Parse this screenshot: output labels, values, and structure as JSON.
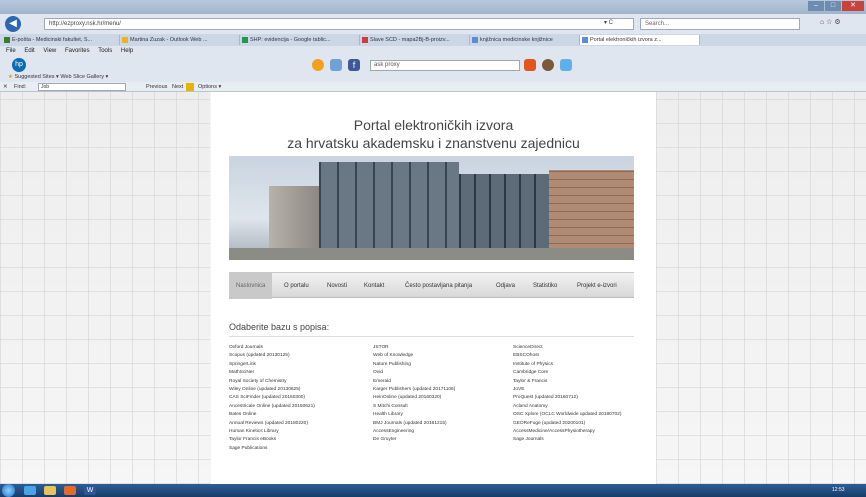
{
  "browser": {
    "address": "http://ezproxy.nsk.hr/menu/",
    "refresh_label": "▾ C",
    "search_placeholder": "Search...",
    "right_icons": "⌂ ☆ ⚙",
    "tabs": [
      "E-pošta - Medicinski fakultet, S...",
      "Martina Zuzak - Outlook Web ...",
      "SHP: evidencija - Google tablic...",
      "Slave SCD - mapa2Bj-B-proizv...",
      "knjižnica medicinske knjižnice",
      "Portal elektroničkih izvora z..."
    ],
    "menu": [
      "File",
      "Edit",
      "View",
      "Favorites",
      "Tools",
      "Help"
    ],
    "favorites": "Suggested Sites ▾   Web Slice Gallery ▾",
    "find_label": "Find:",
    "find_value": "Job",
    "find_prev": "Previous",
    "find_next": "Next",
    "find_options": "Options ▾",
    "toolbar_search": "ask proxy"
  },
  "portal": {
    "title": "Portal elektroničkih izvora",
    "subtitle": "za hrvatsku akademsku i znanstvenu zajednicu",
    "nav": [
      "Naslovnica",
      "O portalu",
      "Novosti",
      "Kontakt",
      "Često postavljana pitanja",
      "Odjava",
      "Statistiko",
      "Projekt e-izvori"
    ],
    "select_heading": "Odaberite bazu s popisa:",
    "databases": {
      "col1": [
        "Oxford Journals",
        "Scopus (updated 20130125)",
        "SpringerLink",
        "MathSciNet",
        "Royal Society of Chemistry",
        "Wiley Online (updated 20130625)",
        "CAS SciFinder (updated 20160300)",
        "Ancestricale Online (updated 20150621)",
        "Bates Online",
        "Annual Reviews (updated 20180220)",
        "Human Kinetics Library",
        "Taylor Francis eBooks",
        "Sage Publications"
      ],
      "col2": [
        "JSTOR",
        "Web of Knowledge",
        "Nature Publishing",
        "Ovid",
        "Emerald",
        "Karger Publishers (updated 20171106)",
        "HeinOnline (updated 20160320)",
        "S Mitchi Consult",
        "Health Library",
        "BMJ Journals (updated 20161215)",
        "AccessEngineering",
        "De Gruyter"
      ],
      "col3": [
        "ScienceDirect",
        "EBSCOhost",
        "Institute of Physics",
        "Cambridge Core",
        "Taylor & Francis",
        "JoVE",
        "ProQuest (updated 20160712)",
        "Acland Anatomy",
        "OSC Xplore (OCLC Worldwide updated 20180702)",
        "GEOReFuge (updated 20200101)",
        "AccessMedicine/AccessPhysiotherapy",
        "Sage Journals"
      ]
    }
  },
  "taskbar": {
    "clock": "12:53"
  },
  "colors": {
    "accent": "#2c67b4",
    "nav_active": "#c9c9c9",
    "taskbar": "#1f4a80"
  }
}
